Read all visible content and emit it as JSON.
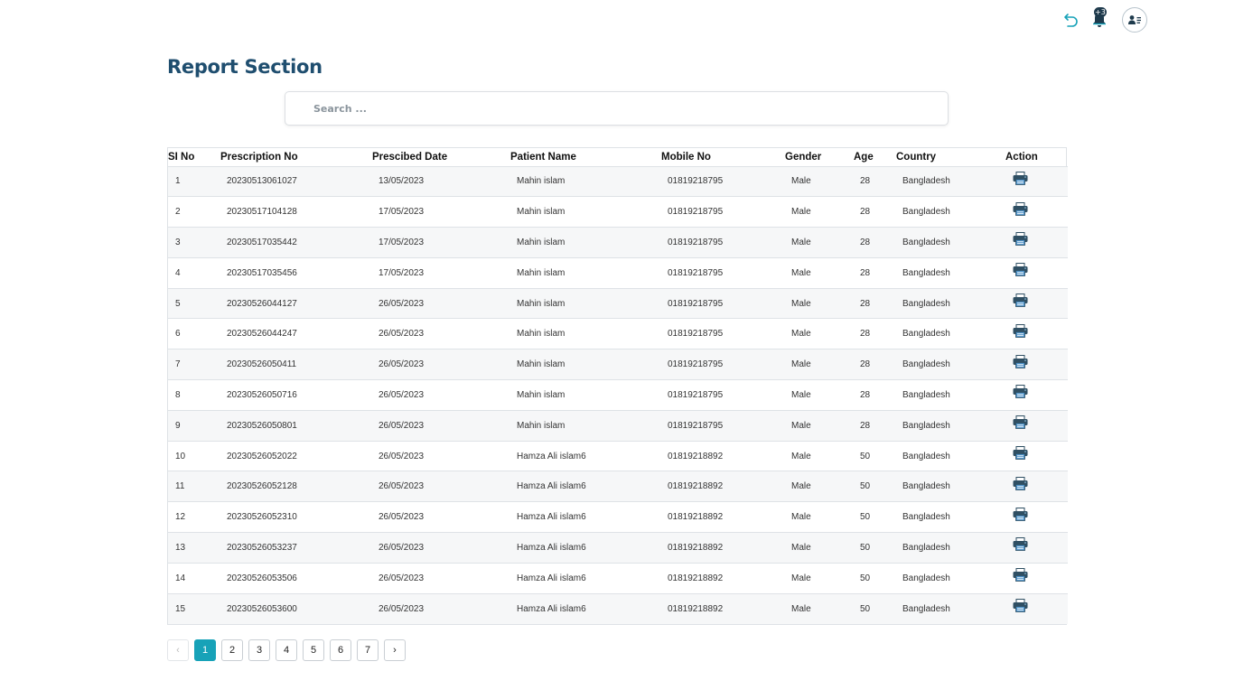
{
  "header": {
    "undo_icon": "undo-icon",
    "notifications": {
      "icon": "bell-icon",
      "badge": "+3"
    },
    "user_icon": "user-card-icon"
  },
  "page": {
    "title": "Report Section"
  },
  "search": {
    "placeholder": "Search ...",
    "value": ""
  },
  "table": {
    "columns": [
      "SI No",
      "Prescription No",
      "Prescibed Date",
      "Patient Name",
      "Mobile No",
      "Gender",
      "Age",
      "Country",
      "Action"
    ],
    "rows": [
      [
        "1",
        "20230513061027",
        "13/05/2023",
        "Mahin islam",
        "01819218795",
        "Male",
        "28",
        "Bangladesh"
      ],
      [
        "2",
        "20230517104128",
        "17/05/2023",
        "Mahin islam",
        "01819218795",
        "Male",
        "28",
        "Bangladesh"
      ],
      [
        "3",
        "20230517035442",
        "17/05/2023",
        "Mahin islam",
        "01819218795",
        "Male",
        "28",
        "Bangladesh"
      ],
      [
        "4",
        "20230517035456",
        "17/05/2023",
        "Mahin islam",
        "01819218795",
        "Male",
        "28",
        "Bangladesh"
      ],
      [
        "5",
        "20230526044127",
        "26/05/2023",
        "Mahin islam",
        "01819218795",
        "Male",
        "28",
        "Bangladesh"
      ],
      [
        "6",
        "20230526044247",
        "26/05/2023",
        "Mahin islam",
        "01819218795",
        "Male",
        "28",
        "Bangladesh"
      ],
      [
        "7",
        "20230526050411",
        "26/05/2023",
        "Mahin islam",
        "01819218795",
        "Male",
        "28",
        "Bangladesh"
      ],
      [
        "8",
        "20230526050716",
        "26/05/2023",
        "Mahin islam",
        "01819218795",
        "Male",
        "28",
        "Bangladesh"
      ],
      [
        "9",
        "20230526050801",
        "26/05/2023",
        "Mahin islam",
        "01819218795",
        "Male",
        "28",
        "Bangladesh"
      ],
      [
        "10",
        "20230526052022",
        "26/05/2023",
        "Hamza Ali islam6",
        "01819218892",
        "Male",
        "50",
        "Bangladesh"
      ],
      [
        "11",
        "20230526052128",
        "26/05/2023",
        "Hamza Ali islam6",
        "01819218892",
        "Male",
        "50",
        "Bangladesh"
      ],
      [
        "12",
        "20230526052310",
        "26/05/2023",
        "Hamza Ali islam6",
        "01819218892",
        "Male",
        "50",
        "Bangladesh"
      ],
      [
        "13",
        "20230526053237",
        "26/05/2023",
        "Hamza Ali islam6",
        "01819218892",
        "Male",
        "50",
        "Bangladesh"
      ],
      [
        "14",
        "20230526053506",
        "26/05/2023",
        "Hamza Ali islam6",
        "01819218892",
        "Male",
        "50",
        "Bangladesh"
      ],
      [
        "15",
        "20230526053600",
        "26/05/2023",
        "Hamza Ali islam6",
        "01819218892",
        "Male",
        "50",
        "Bangladesh"
      ]
    ],
    "action_icon": "printer-icon"
  },
  "pagination": {
    "prev_label": "‹",
    "next_label": "›",
    "pages": [
      "1",
      "2",
      "3",
      "4",
      "5",
      "6",
      "7"
    ],
    "current": "1"
  },
  "colors": {
    "title": "#1f4e6f",
    "accent": "#17a2b8",
    "icon": "#1e3a4c",
    "printer": "#2f4f63"
  }
}
